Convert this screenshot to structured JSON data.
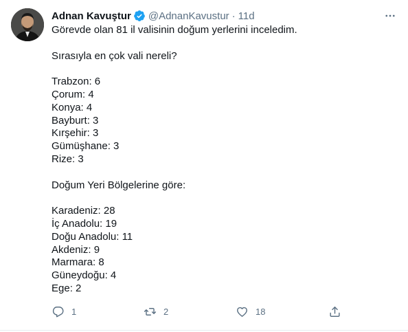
{
  "tweet": {
    "author": {
      "name": "Adnan Kavuştur",
      "handle": "@AdnanKavustur",
      "separator": "·",
      "time": "11d",
      "verified": true
    },
    "lines": [
      "Görevde olan 81 il valisinin doğum yerlerini inceledim.",
      "",
      "Sırasıyla en çok vali nereli?",
      "",
      "Trabzon: 6",
      "Çorum: 4",
      "Konya: 4",
      "Bayburt: 3",
      "Kırşehir: 3",
      "Gümüşhane: 3",
      "Rize: 3",
      "",
      "Doğum Yeri Bölgelerine göre:",
      "",
      "Karadeniz: 28",
      "İç Anadolu: 19",
      "Doğu Anadolu: 11",
      "Akdeniz: 9",
      "Marmara: 8",
      "Güneydoğu: 4",
      "Ege: 2"
    ],
    "actions": {
      "replies": "1",
      "retweets": "2",
      "likes": "18"
    }
  },
  "colors": {
    "text": "#0f1419",
    "secondary": "#5b7083",
    "verified": "#1da1f2",
    "divider": "#e6ecf0"
  },
  "icons": {
    "verified": "verified-badge-icon",
    "more": "more-dots-icon",
    "reply": "reply-icon",
    "retweet": "retweet-icon",
    "like": "heart-icon",
    "share": "share-icon"
  }
}
